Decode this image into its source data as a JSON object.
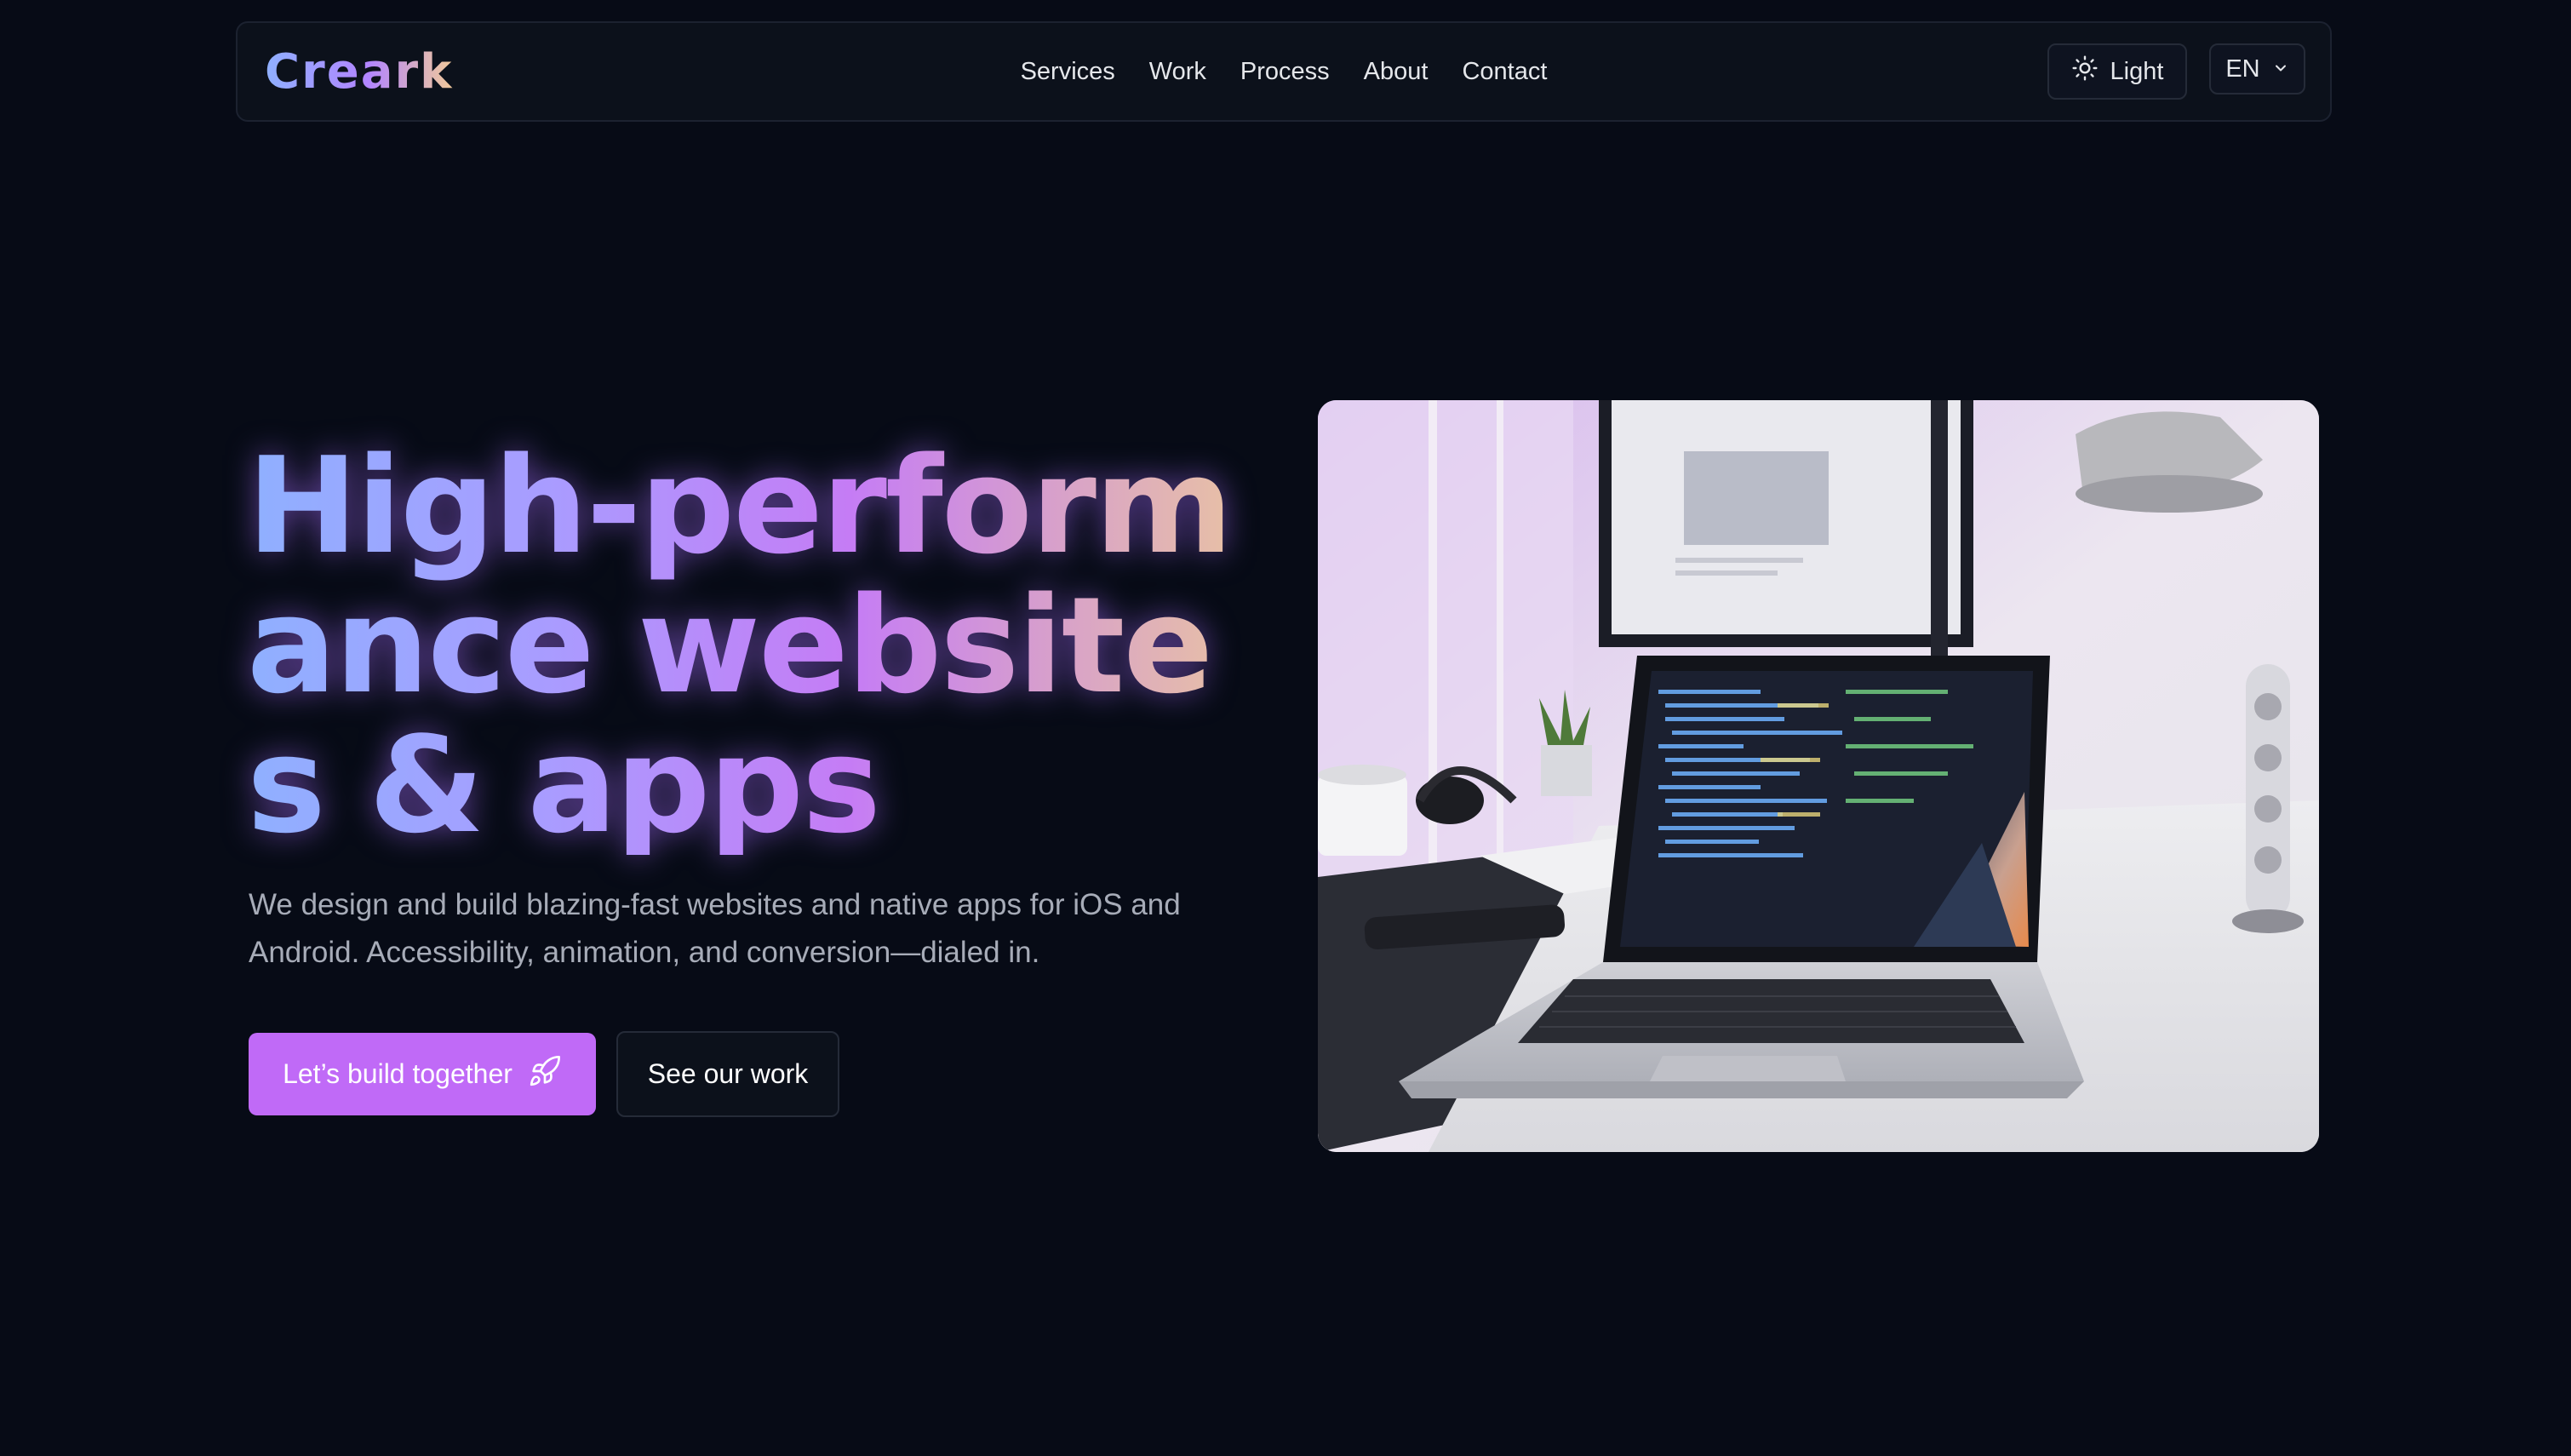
{
  "brand": {
    "logo_text": "Creark"
  },
  "nav": {
    "links": [
      "Services",
      "Work",
      "Process",
      "About",
      "Contact"
    ],
    "theme_toggle": {
      "label": "Light",
      "icon": "sun-icon"
    },
    "language": {
      "selected": "EN",
      "icon": "chevron-down-icon"
    }
  },
  "hero": {
    "headline": "High-performance websites & apps",
    "subtext": "We design and build blazing-fast websites and native apps for iOS and Android. Accessibility, animation, and conversion—dialed in.",
    "primary_cta": {
      "label": "Let’s build together",
      "icon": "rocket-icon"
    },
    "secondary_cta": {
      "label": "See our work"
    },
    "image": {
      "subject": "laptop-with-code-on-desk"
    }
  },
  "colors": {
    "background": "#070b16",
    "navbar_bg": "#0c111b",
    "accent": "#c06af7",
    "gradient_start": "#8fb0ff",
    "gradient_mid": "#c57cf5",
    "gradient_end": "#e9c3a2"
  }
}
